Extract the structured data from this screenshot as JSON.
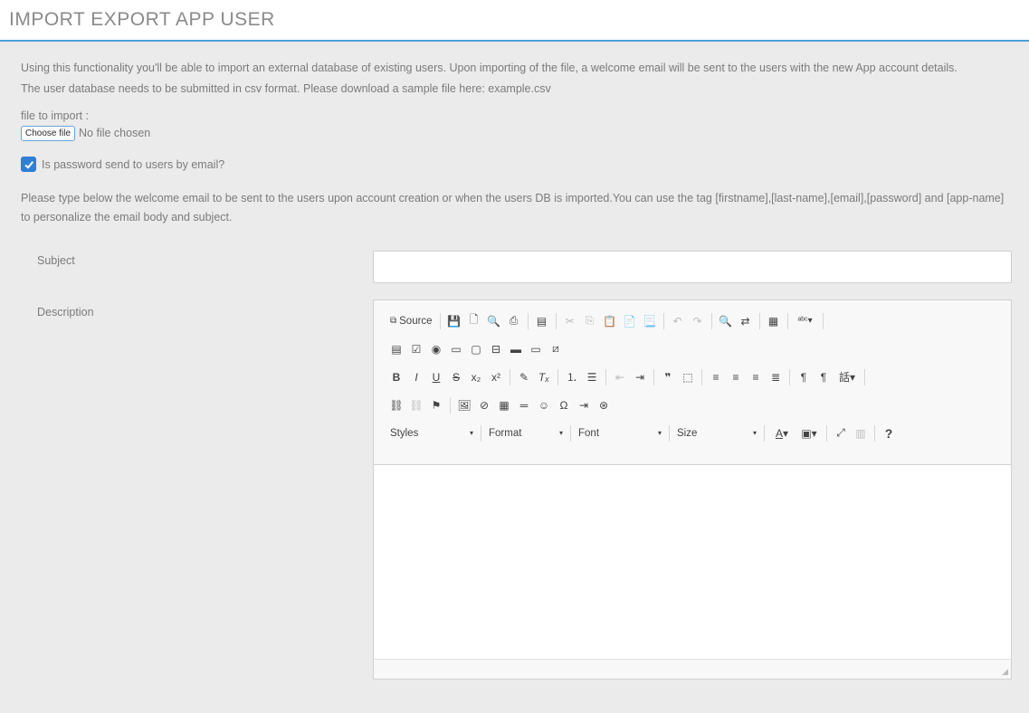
{
  "page": {
    "title": "IMPORT EXPORT APP USER"
  },
  "intro": {
    "text": "Using this functionality you'll be able to import an external database of existing users. Upon importing of the file, a welcome email will be sent to the users with the new App account details.",
    "csv_note": "The user database needs to be submitted in csv format. Please download a sample file here: example.csv"
  },
  "file_import": {
    "label": "file to import :",
    "button": "Choose file",
    "status": "No file chosen"
  },
  "password_checkbox": {
    "label": "Is password send to users by email?",
    "checked": true
  },
  "email_info": "Please type below the welcome email to be sent to the users upon account creation or when the users DB is imported.You can use the tag [firstname],[last-name],[email],[password] and [app-name] to personalize the email body and subject.",
  "form": {
    "subject_label": "Subject",
    "subject_value": "",
    "description_label": "Description"
  },
  "editor": {
    "source_label": "Source",
    "combos": {
      "styles": "Styles",
      "format": "Format",
      "font": "Font",
      "size": "Size"
    },
    "help": "?"
  },
  "colors": {
    "accent": "#4a9fd6",
    "checkbox": "#2f7fd6",
    "background": "#ebebeb"
  }
}
